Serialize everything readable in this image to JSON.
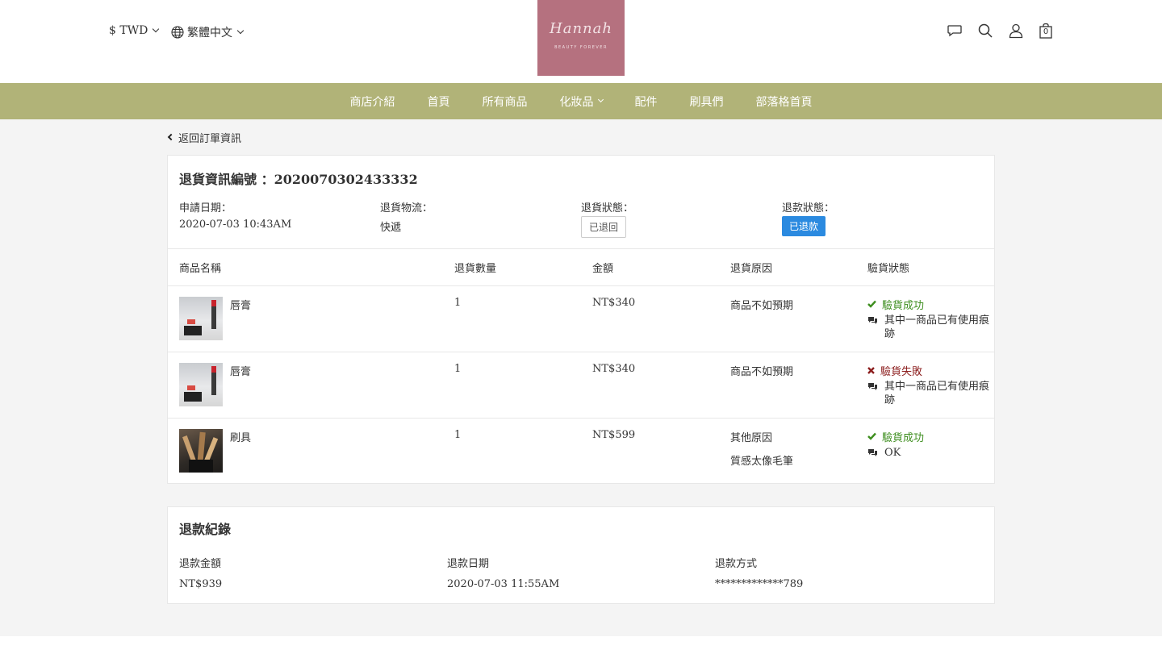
{
  "header": {
    "currency": "$ TWD",
    "language": "繁體中文",
    "logo_text": "Hannah",
    "logo_tagline": "BEAUTY FOREVER",
    "cart_count": "0"
  },
  "nav": {
    "items": [
      {
        "label": "商店介紹"
      },
      {
        "label": "首頁"
      },
      {
        "label": "所有商品"
      },
      {
        "label": "化妝品"
      },
      {
        "label": "配件"
      },
      {
        "label": "刷具們"
      },
      {
        "label": "部落格首頁"
      }
    ]
  },
  "back_label": "返回訂單資訊",
  "return": {
    "title": "退貨資訊編號 ：2020070302433332",
    "apply_date_label": "申請日期：",
    "apply_date": "2020-07-03 10:43AM",
    "logistics_label": "退貨物流：",
    "logistics": "快遞",
    "status_label": "退貨狀態：",
    "status": "已退回",
    "refund_status_label": "退款狀態：",
    "refund_status": "已退款"
  },
  "table": {
    "headers": [
      "商品名稱",
      "退貨數量",
      "金額",
      "退貨原因",
      "驗貨狀態"
    ],
    "rows": [
      {
        "name": "唇膏",
        "qty": "1",
        "amount": "NT$340",
        "reason": "商品不如預期",
        "reason_note": "",
        "inspect": "驗貨成功",
        "inspect_ok": true,
        "note": "其中一商品已有使用痕跡"
      },
      {
        "name": "唇膏",
        "qty": "1",
        "amount": "NT$340",
        "reason": "商品不如預期",
        "reason_note": "",
        "inspect": "驗貨失敗",
        "inspect_ok": false,
        "note": "其中一商品已有使用痕跡"
      },
      {
        "name": "刷具",
        "qty": "1",
        "amount": "NT$599",
        "reason": "其他原因",
        "reason_note": "質感太像毛筆",
        "inspect": "驗貨成功",
        "inspect_ok": true,
        "note": "OK"
      }
    ]
  },
  "refund": {
    "title": "退款紀錄",
    "amount_label": "退款金額",
    "amount": "NT$939",
    "date_label": "退款日期",
    "date": "2020-07-03 11:55AM",
    "method_label": "退款方式",
    "method": "*************789"
  },
  "colors": {
    "nav_bg": "#b1b378",
    "logo_bg": "#b5717f",
    "refund_badge": "#2b8ae0",
    "success": "#3e8e1f",
    "fail": "#8c1e1e"
  }
}
